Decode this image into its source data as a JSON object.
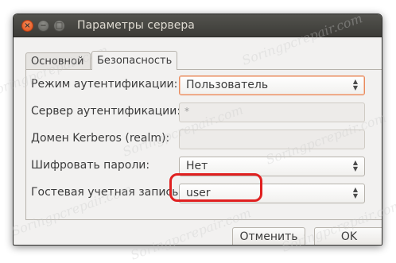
{
  "window": {
    "title": "Параметры сервера",
    "controls": {
      "close": "×",
      "minimize": "−",
      "maximize": "□"
    }
  },
  "tabs": [
    {
      "label": "Основной",
      "active": false
    },
    {
      "label": "Безопасность",
      "active": true
    }
  ],
  "form": {
    "auth_mode": {
      "label": "Режим аутентификации:",
      "value": "Пользователь"
    },
    "auth_server": {
      "label": "Сервер аутентификации:",
      "value": "*"
    },
    "kerberos": {
      "label": "Домен Kerberos (realm):",
      "value": ""
    },
    "encrypt": {
      "label": "Шифровать пароли:",
      "value": "Нет"
    },
    "guest": {
      "label": "Гостевая учетная запись:",
      "value": "user"
    }
  },
  "buttons": {
    "cancel": "Отменить",
    "ok": "OK"
  },
  "watermark": "Soringpcrepair.com",
  "colors": {
    "focus_border": "#e98b5e",
    "highlight": "#e02020",
    "titlebar": "#3c3b37"
  }
}
